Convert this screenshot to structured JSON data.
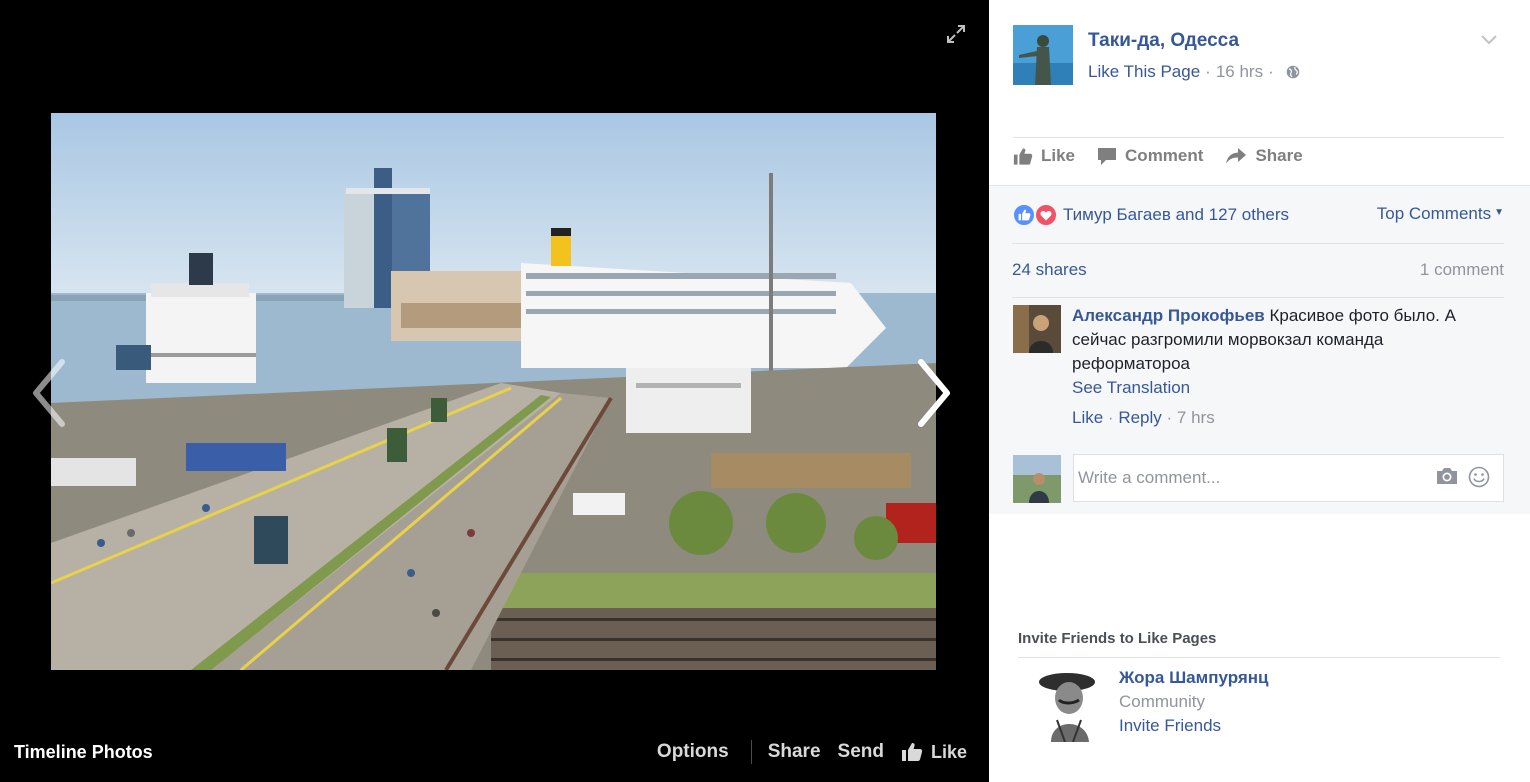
{
  "viewer": {
    "photo_alt": "",
    "album_title": "Timeline Photos",
    "footer": {
      "options_label": "Options",
      "share_label": "Share",
      "send_label": "Send",
      "like_label": "Like"
    }
  },
  "post": {
    "page_name": "Таки-да, Одесса",
    "like_page_label": "Like This Page",
    "time": "16 hrs",
    "actions": {
      "like": "Like",
      "comment": "Comment",
      "share": "Share"
    },
    "reactions_text": "Тимур Багаев and 127 others",
    "top_comments_label": "Top Comments",
    "shares_text": "24 shares",
    "comment_count_text": "1 comment",
    "comment": {
      "author": "Александр Прокофьев",
      "text": "Красивое фото было. А сейчас разгромили морвокзал команда реформатороа",
      "see_translation": "See Translation",
      "like_label": "Like",
      "reply_label": "Reply",
      "time": "7 hrs"
    },
    "comment_input_placeholder": "Write a comment..."
  },
  "invite": {
    "title": "Invite Friends to Like Pages",
    "suggestion": {
      "name": "Жора Шампурянц",
      "type": "Community",
      "invite_label": "Invite Friends"
    }
  },
  "colors": {
    "link_blue": "#365899",
    "muted_gray": "#90949c",
    "viewer_bg": "#000000",
    "like_reaction": "#5890ff",
    "love_reaction": "#f25268"
  },
  "icons": [
    "expand-icon",
    "chevron-left-icon",
    "chevron-right-icon",
    "thumbs-up-icon",
    "comment-icon",
    "share-icon",
    "globe-icon",
    "chevron-down-icon",
    "camera-icon",
    "emoji-icon"
  ]
}
